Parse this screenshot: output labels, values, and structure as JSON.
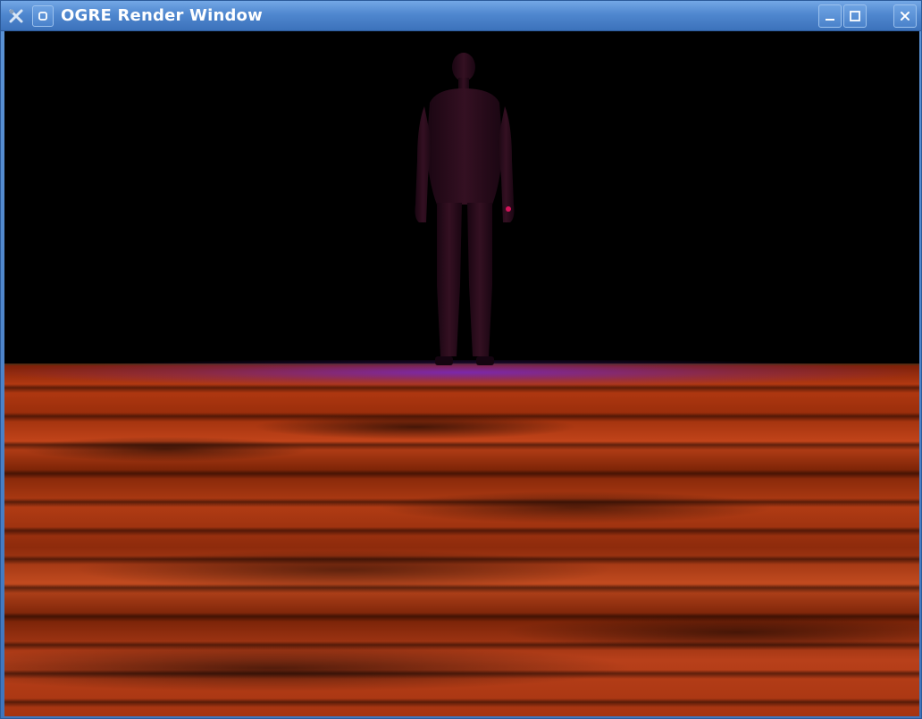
{
  "window": {
    "title": "OGRE Render Window",
    "app_icon": "tool-icon",
    "menu_icon": "window-menu-icon",
    "buttons": {
      "minimize": "minimize-icon",
      "maximize": "maximize-icon",
      "close": "close-icon"
    }
  },
  "scene": {
    "sky_color": "#000000",
    "floor_color": "#b53a12",
    "glow_color": "#7828c8",
    "figure_color": "#2a0a1a"
  }
}
